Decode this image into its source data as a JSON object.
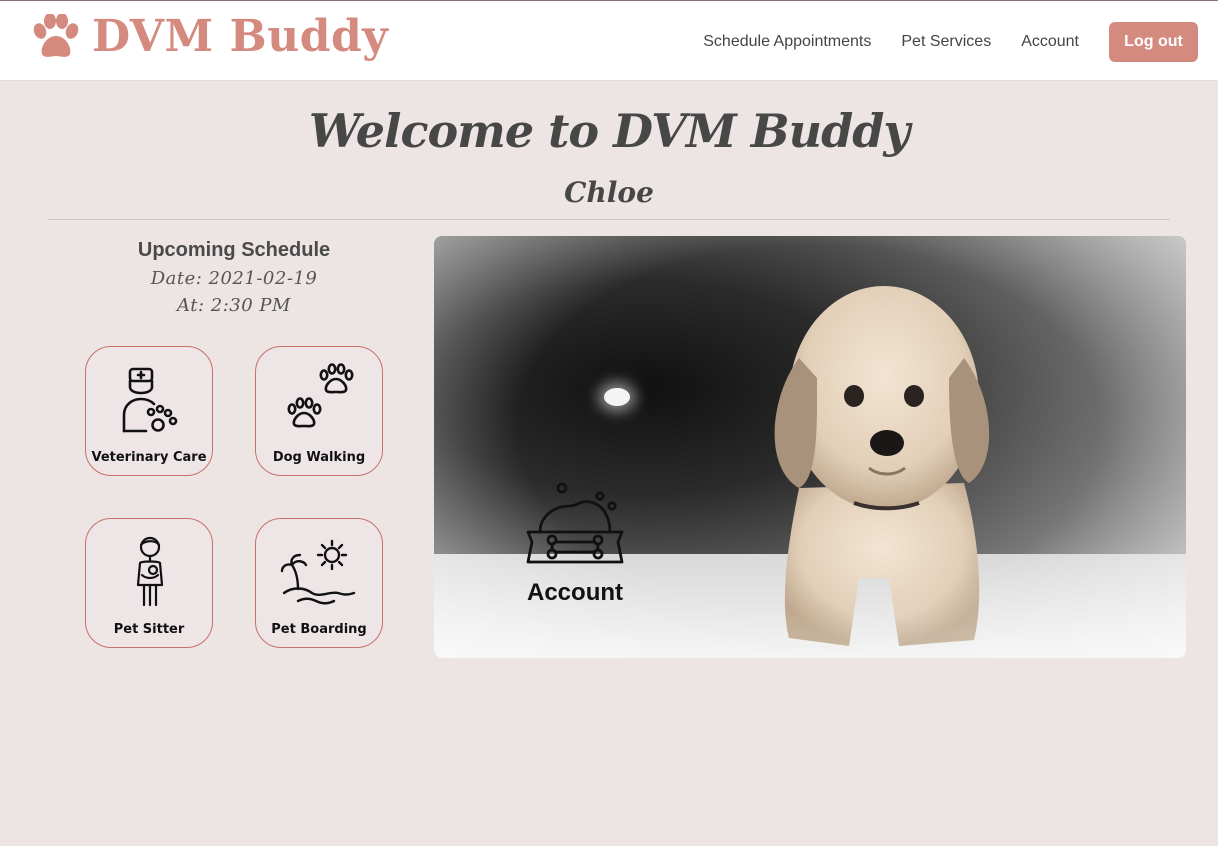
{
  "header": {
    "brand_name": "DVM Buddy",
    "nav": {
      "schedule": "Schedule Appointments",
      "services": "Pet Services",
      "account": "Account"
    },
    "logout_label": "Log out"
  },
  "welcome": {
    "title": "Welcome to DVM Buddy",
    "user": "Chloe"
  },
  "schedule": {
    "title": "Upcoming Schedule",
    "date_line": "Date: 2021-02-19",
    "time_line": "At: 2:30 PM"
  },
  "services": [
    {
      "label": "Veterinary Care",
      "icon": "veterinarian-icon"
    },
    {
      "label": "Dog Walking",
      "icon": "paw-prints-icon"
    },
    {
      "label": "Pet Sitter",
      "icon": "pet-sitter-icon"
    },
    {
      "label": "Pet Boarding",
      "icon": "island-sun-icon"
    }
  ],
  "hero": {
    "account_label": "Account",
    "account_icon": "food-bowl-icon"
  },
  "colors": {
    "brand": "#d58a7f",
    "background": "#ede4e4",
    "tile_border": "#c8706a",
    "text": "#444444"
  }
}
